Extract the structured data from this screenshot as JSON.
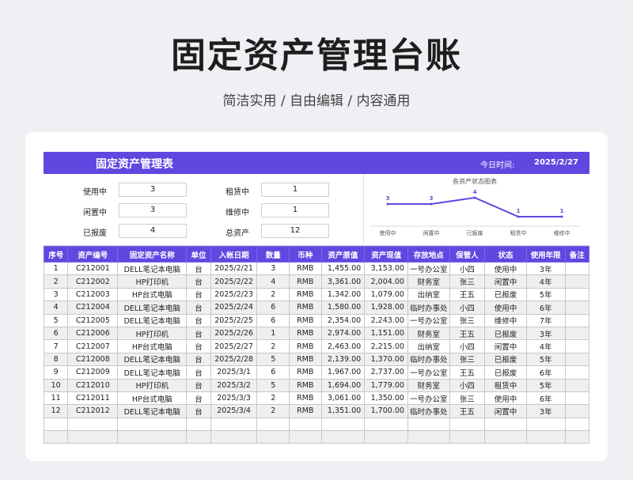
{
  "page": {
    "title": "固定资产管理台账",
    "subtitle": "简洁实用 / 自由编辑 / 内容通用"
  },
  "sheet": {
    "banner_title": "固定资产管理表",
    "date_label": "今日时间:",
    "date_value": "2025/2/27"
  },
  "summary": {
    "in_use_label": "使用中",
    "in_use_value": "3",
    "idle_label": "闲置中",
    "idle_value": "3",
    "scrapped_label": "已报废",
    "scrapped_value": "4",
    "leased_label": "租赁中",
    "leased_value": "1",
    "repair_label": "维修中",
    "repair_value": "1",
    "total_label": "总资产",
    "total_value": "12"
  },
  "chart_data": {
    "type": "line",
    "title": "各资产状态图表",
    "categories": [
      "使用中",
      "闲置中",
      "已报废",
      "租赁中",
      "维修中"
    ],
    "values": [
      3,
      3,
      4,
      1,
      1
    ],
    "ylim": [
      0,
      5
    ],
    "grid": false,
    "color": "#6047e0"
  },
  "table": {
    "headers": [
      "序号",
      "资产编号",
      "固定资产名称",
      "单位",
      "入帐日期",
      "数量",
      "币种",
      "资产原值",
      "资产现值",
      "存放地点",
      "保管人",
      "状态",
      "使用年限",
      "备注"
    ],
    "rows": [
      [
        "1",
        "C212001",
        "DELL笔记本电脑",
        "台",
        "2025/2/21",
        "3",
        "RMB",
        "1,455.00",
        "3,153.00",
        "一号办公室",
        "小四",
        "使用中",
        "3年",
        ""
      ],
      [
        "2",
        "C212002",
        "HP打印机",
        "台",
        "2025/2/22",
        "4",
        "RMB",
        "3,361.00",
        "2,004.00",
        "财务室",
        "张三",
        "闲置中",
        "4年",
        ""
      ],
      [
        "3",
        "C212003",
        "HP台式电脑",
        "台",
        "2025/2/23",
        "2",
        "RMB",
        "1,342.00",
        "1,079.00",
        "出纳室",
        "王五",
        "已报废",
        "5年",
        ""
      ],
      [
        "4",
        "C212004",
        "DELL笔记本电脑",
        "台",
        "2025/2/24",
        "6",
        "RMB",
        "1,580.00",
        "1,928.00",
        "临时办事处",
        "小四",
        "使用中",
        "6年",
        ""
      ],
      [
        "5",
        "C212005",
        "DELL笔记本电脑",
        "台",
        "2025/2/25",
        "6",
        "RMB",
        "2,354.00",
        "2,243.00",
        "一号办公室",
        "张三",
        "维修中",
        "7年",
        ""
      ],
      [
        "6",
        "C212006",
        "HP打印机",
        "台",
        "2025/2/26",
        "1",
        "RMB",
        "2,974.00",
        "1,151.00",
        "财务室",
        "王五",
        "已报废",
        "3年",
        ""
      ],
      [
        "7",
        "C212007",
        "HP台式电脑",
        "台",
        "2025/2/27",
        "2",
        "RMB",
        "2,463.00",
        "2,215.00",
        "出纳室",
        "小四",
        "闲置中",
        "4年",
        ""
      ],
      [
        "8",
        "C212008",
        "DELL笔记本电脑",
        "台",
        "2025/2/28",
        "5",
        "RMB",
        "2,139.00",
        "1,370.00",
        "临时办事处",
        "张三",
        "已报废",
        "5年",
        ""
      ],
      [
        "9",
        "C212009",
        "DELL笔记本电脑",
        "台",
        "2025/3/1",
        "6",
        "RMB",
        "1,967.00",
        "2,737.00",
        "一号办公室",
        "王五",
        "已报废",
        "6年",
        ""
      ],
      [
        "10",
        "C212010",
        "HP打印机",
        "台",
        "2025/3/2",
        "5",
        "RMB",
        "1,694.00",
        "1,779.00",
        "财务室",
        "小四",
        "租赁中",
        "5年",
        ""
      ],
      [
        "11",
        "C212011",
        "HP台式电脑",
        "台",
        "2025/3/3",
        "2",
        "RMB",
        "3,061.00",
        "1,350.00",
        "一号办公室",
        "张三",
        "使用中",
        "6年",
        ""
      ],
      [
        "12",
        "C212012",
        "DELL笔记本电脑",
        "台",
        "2025/3/4",
        "2",
        "RMB",
        "1,351.00",
        "1,700.00",
        "临时办事处",
        "王五",
        "闲置中",
        "3年",
        ""
      ],
      [
        "",
        "",
        "",
        "",
        "",
        "",
        "",
        "",
        "",
        "",
        "",
        "",
        "",
        ""
      ],
      [
        "",
        "",
        "",
        "",
        "",
        "",
        "",
        "",
        "",
        "",
        "",
        "",
        "",
        ""
      ]
    ]
  }
}
